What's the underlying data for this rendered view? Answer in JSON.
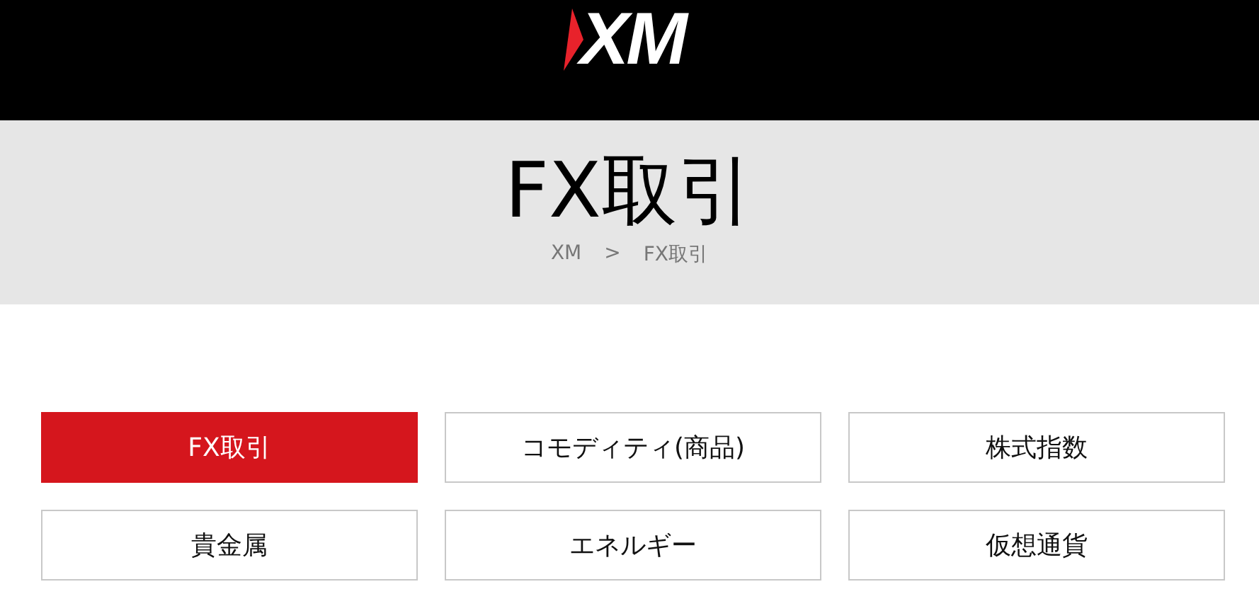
{
  "header": {
    "logo": "XM"
  },
  "hero": {
    "title": "FX取引",
    "breadcrumb": [
      {
        "label": "XM"
      },
      {
        "label": "FX取引"
      }
    ],
    "separator": ">"
  },
  "categories": [
    {
      "label": "FX取引",
      "selected": true
    },
    {
      "label": "コモディティ(商品)",
      "selected": false
    },
    {
      "label": "株式指数",
      "selected": false
    },
    {
      "label": "貴金属",
      "selected": false
    },
    {
      "label": "エネルギー",
      "selected": false
    },
    {
      "label": "仮想通貨",
      "selected": false
    }
  ]
}
